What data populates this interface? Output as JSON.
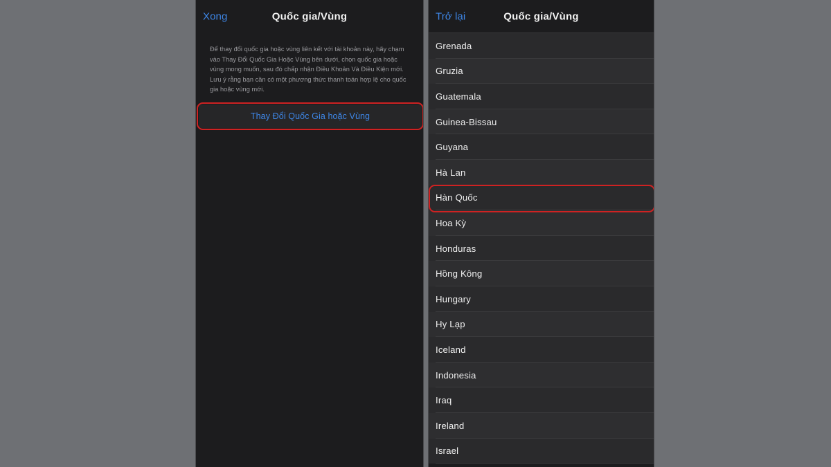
{
  "background_color": "#6e7074",
  "accent_color": "#3e87e8",
  "highlight_color": "#cf2222",
  "panel_bg": "#1c1c1e",
  "left_panel": {
    "nav": {
      "left_button": "Xong",
      "title": "Quốc gia/Vùng"
    },
    "description": "Để thay đổi quốc gia hoặc vùng liên kết với tài khoản này, hãy chạm vào Thay Đổi Quốc Gia Hoặc Vùng bên dưới, chọn quốc gia hoặc vùng mong muốn, sau đó chấp nhận Điều Khoản Và Điều Kiện mới. Lưu ý rằng bạn cần có một phương thức thanh toán hợp lệ cho quốc gia hoặc vùng mới.",
    "change_button_label": "Thay Đổi Quốc Gia hoặc Vùng"
  },
  "right_panel": {
    "nav": {
      "left_button": "Trở lại",
      "title": "Quốc gia/Vùng"
    },
    "selected_country": "Hàn Quốc",
    "countries": [
      "Grenada",
      "Gruzia",
      "Guatemala",
      "Guinea-Bissau",
      "Guyana",
      "Hà Lan",
      "Hàn Quốc",
      "Hoa Kỳ",
      "Honduras",
      "Hồng Kông",
      "Hungary",
      "Hy Lạp",
      "Iceland",
      "Indonesia",
      "Iraq",
      "Ireland",
      "Israel"
    ]
  }
}
